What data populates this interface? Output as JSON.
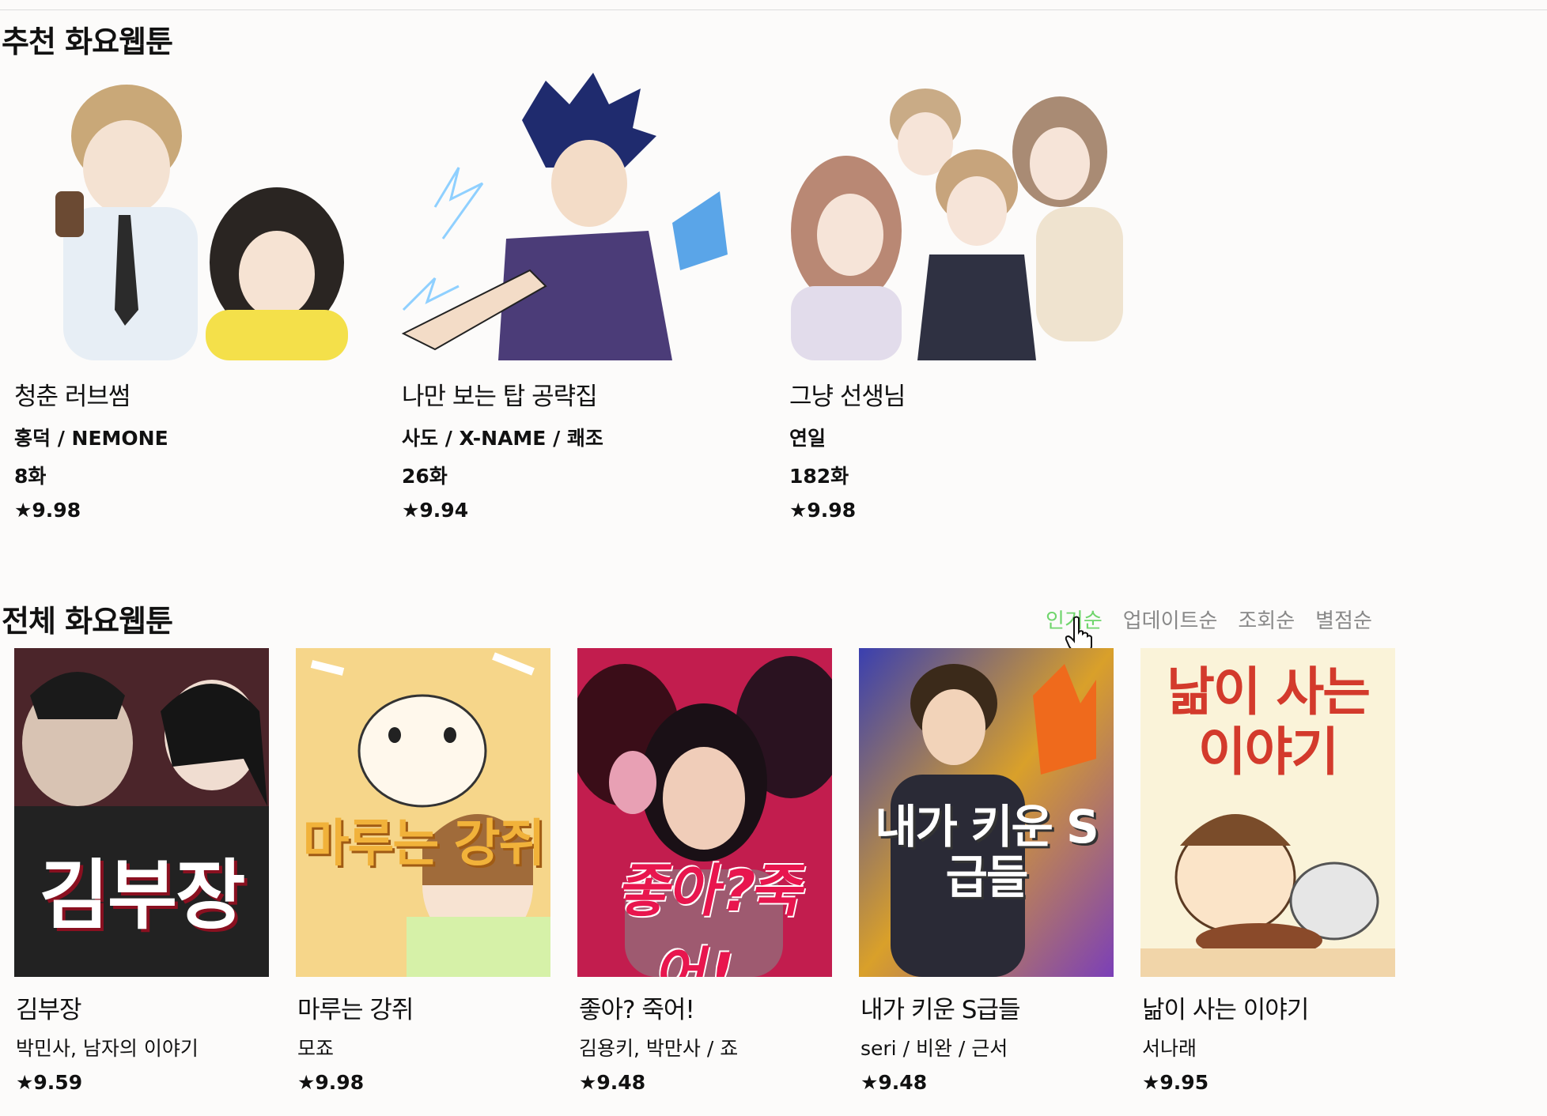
{
  "sections": {
    "recommended_title": "추천 화요웹툰",
    "all_title": "전체 화요웹툰"
  },
  "sort_tabs": [
    "인기순",
    "업데이트순",
    "조회순",
    "별점순"
  ],
  "active_sort": "인기순",
  "recommended": [
    {
      "title": "청춘 러브썸",
      "author": "홍덕 / NEMONE",
      "episodes": "8화",
      "rating": "★9.98"
    },
    {
      "title": "나만 보는 탑 공략집",
      "author": "사도 / X-NAME / 쾌조",
      "episodes": "26화",
      "rating": "★9.94"
    },
    {
      "title": "그냥 선생님",
      "author": "연일",
      "episodes": "182화",
      "rating": "★9.98"
    }
  ],
  "all": [
    {
      "title": "김부장",
      "author": "박민사, 남자의 이야기",
      "rating": "★9.59",
      "cover_text": "김부장"
    },
    {
      "title": "마루는 강쥐",
      "author": "모죠",
      "rating": "★9.98",
      "cover_text": "마루는 강쥐"
    },
    {
      "title": "좋아? 죽어!",
      "author": "김용키, 박만사 / 죠",
      "rating": "★9.48",
      "cover_text": "좋아?죽어!"
    },
    {
      "title": "내가 키운 S급들",
      "author": "seri / 비완 / 근서",
      "rating": "★9.48",
      "cover_text": "내가 키운 S급들"
    },
    {
      "title": "낢이 사는 이야기",
      "author": "서나래",
      "rating": "★9.95",
      "cover_text": "낢이 사는 이야기"
    }
  ],
  "colors": {
    "active_tab": "#6fd56c",
    "inactive_tab": "#888888",
    "background": "#fcfbfa"
  }
}
